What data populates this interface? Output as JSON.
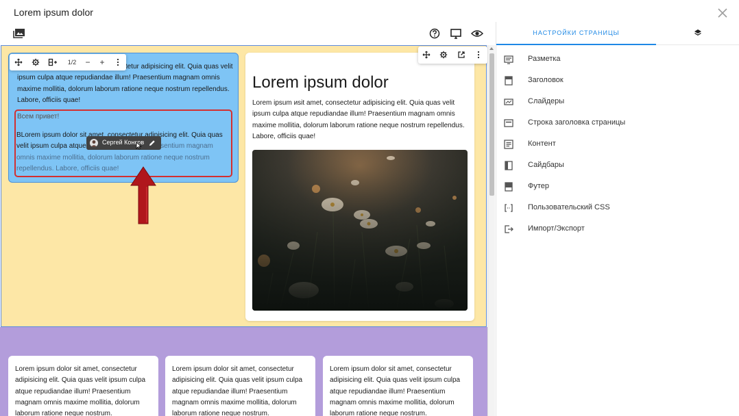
{
  "window": {
    "title": "Lorem ipsum dolor"
  },
  "toolbar_top": {
    "icons": [
      "gallery-icon",
      "help-icon",
      "desktop-icon",
      "eye-icon"
    ]
  },
  "settings_panel": {
    "tabs": [
      {
        "label": "НАСТРОЙКИ СТРАНИЦЫ",
        "icon": "",
        "active": true
      },
      {
        "label": "",
        "icon": "layers-icon",
        "active": false
      }
    ],
    "items": [
      {
        "label": "Разметка",
        "icon": "layout-icon"
      },
      {
        "label": "Заголовок",
        "icon": "header-icon"
      },
      {
        "label": "Слайдеры",
        "icon": "slider-icon"
      },
      {
        "label": "Строка заголовка страницы",
        "icon": "title-bar-icon"
      },
      {
        "label": "Контент",
        "icon": "content-icon"
      },
      {
        "label": "Сайдбары",
        "icon": "sidebar-icon"
      },
      {
        "label": "Футер",
        "icon": "footer-icon"
      },
      {
        "label": "Пользовательский CSS",
        "icon": "css-icon"
      },
      {
        "label": "Импорт/Экспорт",
        "icon": "import-export-icon"
      }
    ]
  },
  "block_toolbar": {
    "pager": "1/2",
    "minus": "−",
    "plus": "+"
  },
  "text_block": {
    "paragraph": "Lorem ipsum dolor sit amet, consectetur adipisicing elit. Quia quas velit ipsum culpa atque repudiandae illum! Praesentium magnam omnis maxime mollitia, dolorum laborum ratione neque nostrum repellendus. Labore, officiis quae!",
    "greeting": "Всем привет!",
    "second_paragraph_start": "BLorem ipsum dolor sit amet, consectetur adipisicing elit. Quia quas velit ipsum culpa atque",
    "second_paragraph_end": " repudiandae illum! Praesentium magnam omnis maxime mollitia, dolorum laborum ratione neque nostrum repellendus. Labore, officiis quae!"
  },
  "collaborator": {
    "name": "Сергей Конков"
  },
  "card_right": {
    "title": "Lorem ipsum dolor",
    "paragraph": "Lorem ipsum иsit amet, consectetur adipisicing elit. Quia quas velit ipsum culpa atque repudiandae illum! Praesentium magnam omnis maxime mollitia, dolorum laborum ratione neque nostrum repellendus. Labore, officiis quae!"
  },
  "bottom_cards": [
    {
      "text": "Lorem ipsum dolor sit amet, consectetur adipisicing elit. Quia quas velit ipsum culpa atque repudiandae illum! Praesentium magnam omnis maxime mollitia, dolorum laborum ratione neque nostrum."
    },
    {
      "text": "Lorem ipsum dolor sit amet, consectetur adipisicing elit. Quia quas velit ipsum culpa atque repudiandae illum! Praesentium magnam omnis maxime mollitia, dolorum laborum ratione neque nostrum."
    },
    {
      "text": "Lorem ipsum dolor sit amet, consectetur adipisicing elit. Quia quas velit ipsum culpa atque repudiandae illum! Praesentium magnam omnis maxime mollitia, dolorum laborum ratione neque nostrum."
    }
  ],
  "colors": {
    "accent": "#1e88e5",
    "section_yellow": "#fde7a6",
    "section_purple": "#b39ddb",
    "selected_block": "#7ec4f5",
    "highlight_red": "#d32f2f"
  }
}
